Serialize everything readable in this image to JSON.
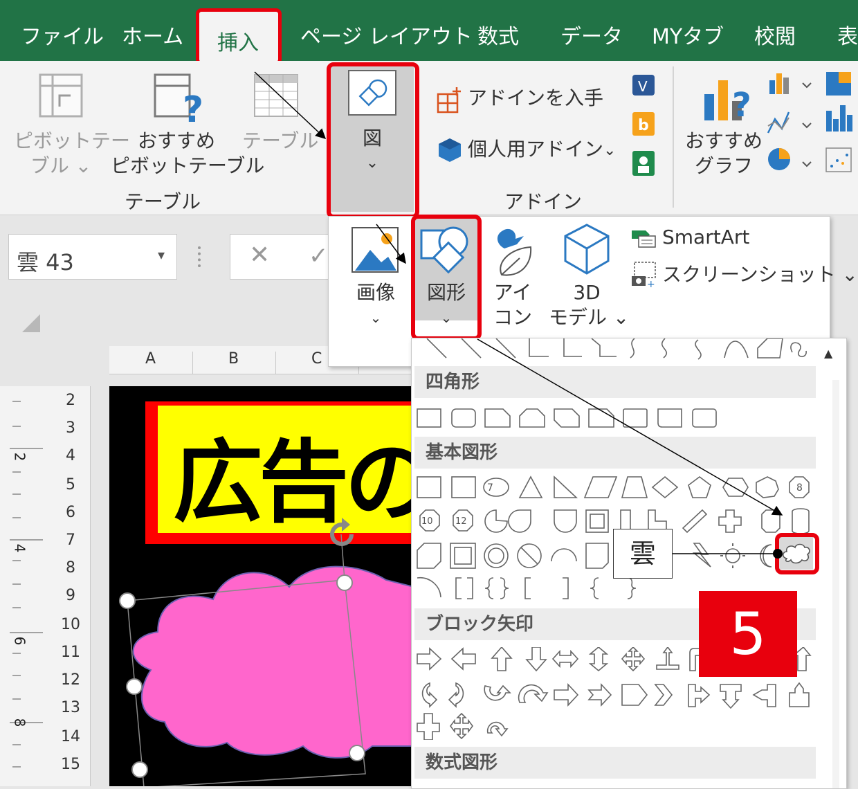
{
  "tabs": [
    "ファイル",
    "ホーム",
    "挿入",
    "ページ レイアウト",
    "数式",
    "データ",
    "MYタブ",
    "校閲",
    "表"
  ],
  "active_tab": "挿入",
  "ribbon": {
    "pivot_table": [
      "ピボットテー",
      "ブル ⌄"
    ],
    "recommended_pivot": [
      "おすすめ",
      "ピボットテーブル"
    ],
    "table": "テーブル",
    "group_table": "テーブル",
    "illustrations": {
      "label": "図",
      "chevron": "⌄"
    },
    "get_addins": "アドインを入手",
    "personal_addins": "個人用アドイン",
    "addin_chevron": "⌄",
    "group_addin": "アドイン",
    "recommended_chart": [
      "おすすめ",
      "グラフ"
    ]
  },
  "formula_bar": {
    "name_box": "雲 43",
    "dropdown": "▾",
    "cancel": "✕",
    "confirm": "✓"
  },
  "columns": [
    "A",
    "B",
    "C"
  ],
  "rows": [
    "2",
    "3",
    "4",
    "5",
    "6",
    "7",
    "8",
    "9",
    "10",
    "11",
    "12",
    "13",
    "14",
    "15"
  ],
  "ruler_marks": [
    "2",
    "4",
    "6",
    "8"
  ],
  "sheet_text": "広告の",
  "picture_panel": {
    "image": [
      "画像",
      "⌄"
    ],
    "shapes": [
      "図形",
      "⌄"
    ],
    "icons": [
      "アイ",
      "コン"
    ],
    "model3d": [
      "3D",
      "モデル ⌄"
    ],
    "smartart": "SmartArt",
    "screenshot": "スクリーンショット ⌄"
  },
  "shape_panel": {
    "categories": [
      "四角形",
      "基本図形",
      "ブロック矢印",
      "数式図形"
    ],
    "scroll_up": "▲",
    "basic_shape_labels": [
      "7",
      "8",
      "10",
      "12"
    ]
  },
  "tooltip": "雲",
  "step_badge": "5"
}
